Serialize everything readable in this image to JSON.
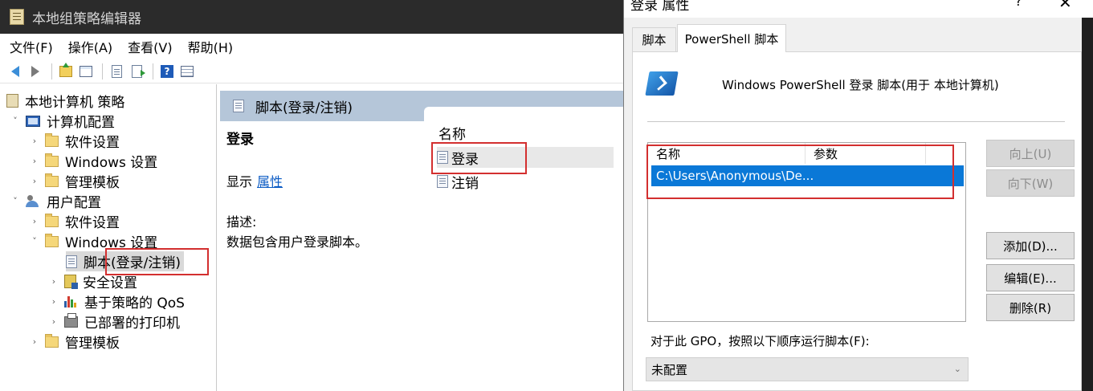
{
  "window": {
    "title": "本地组策略编辑器"
  },
  "menu": [
    "文件(F)",
    "操作(A)",
    "查看(V)",
    "帮助(H)"
  ],
  "toolbar": {
    "help_glyph": "?"
  },
  "tree": {
    "root": "本地计算机 策略",
    "computer_config": "计算机配置",
    "computer_software": "软件设置",
    "computer_windows": "Windows 设置",
    "computer_admin": "管理模板",
    "user_config": "用户配置",
    "user_software": "软件设置",
    "user_windows": "Windows 设置",
    "user_scripts": "脚本(登录/注销)",
    "user_security": "安全设置",
    "user_qos": "基于策略的 QoS",
    "user_printers": "已部署的打印机",
    "user_admin": "管理模板",
    "expand_glyph": "›",
    "collapse_glyph": "˅"
  },
  "detail": {
    "header": "脚本(登录/注销)",
    "selected_title": "登录",
    "show_label": "显示",
    "properties_link": "属性",
    "description_label": "描述:",
    "description_text": "数据包含用户登录脚本。",
    "list_header": "名称",
    "items": [
      "登录",
      "注销"
    ]
  },
  "dialog": {
    "title": "登录 属性",
    "help_glyph": "?",
    "close_glyph": "✕",
    "tabs": [
      "脚本",
      "PowerShell 脚本"
    ],
    "active_tab": "PowerShell 脚本",
    "caption": "Windows PowerShell 登录 脚本(用于 本地计算机)",
    "columns": [
      "名称",
      "参数"
    ],
    "rows": [
      {
        "name": "C:\\Users\\Anonymous\\De...",
        "params": ""
      }
    ],
    "buttons": {
      "up": "向上(U)",
      "down": "向下(W)",
      "add": "添加(D)...",
      "edit": "编辑(E)...",
      "remove": "删除(R)"
    },
    "order_label": "对于此 GPO，按照以下顺序运行脚本(F):",
    "order_value": "未配置",
    "chevron_glyph": "⌄"
  },
  "colors": {
    "title_bar": "#2b2b2b",
    "detail_header": "#b5c6d9",
    "selection": "#0a78d7",
    "link": "#0b5bc4",
    "highlight_box": "#d32f2f"
  }
}
